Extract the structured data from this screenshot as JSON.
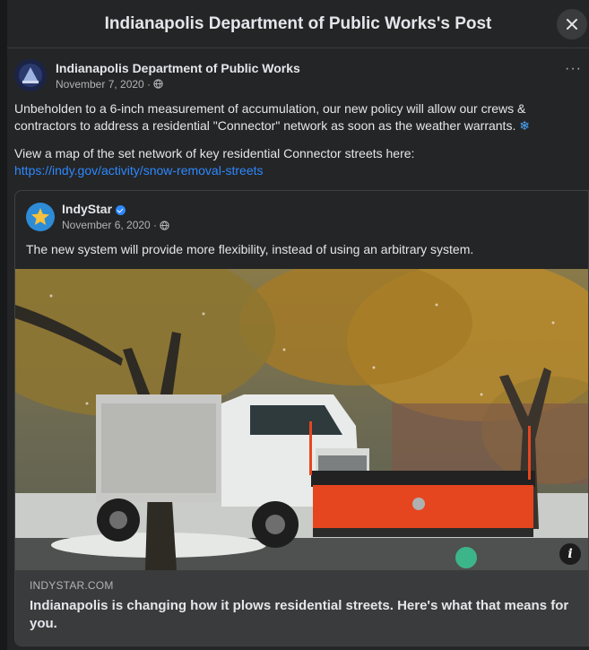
{
  "modal": {
    "title": "Indianapolis Department of Public Works's Post",
    "close_icon": "close-icon"
  },
  "post": {
    "author": "Indianapolis Department of Public Works",
    "date": "November 7, 2020 ·",
    "privacy_icon": "globe-icon",
    "more_label": "···",
    "text": "Unbeholden to a 6-inch measurement of accumulation, our new policy will allow our crews & contractors to address a residential \"Connector\" network as soon as the weather warrants.",
    "snow_emoji": "❄",
    "map_text": "View a map of the set network of key residential Connector streets here:",
    "link": "https://indy.gov/activity/snow-removal-streets"
  },
  "shared": {
    "author": "IndyStar",
    "date": "November 6, 2020 ·",
    "text": "The new system will provide more flexibility, instead of using an arbitrary system.",
    "info_label": "i",
    "link_domain": "INDYSTAR.COM",
    "link_title": "Indianapolis is changing how it plows residential streets. Here's what that means for you."
  },
  "colors": {
    "background": "#242526",
    "link": "#2d88ff",
    "plow_blade": "#e5461f"
  }
}
